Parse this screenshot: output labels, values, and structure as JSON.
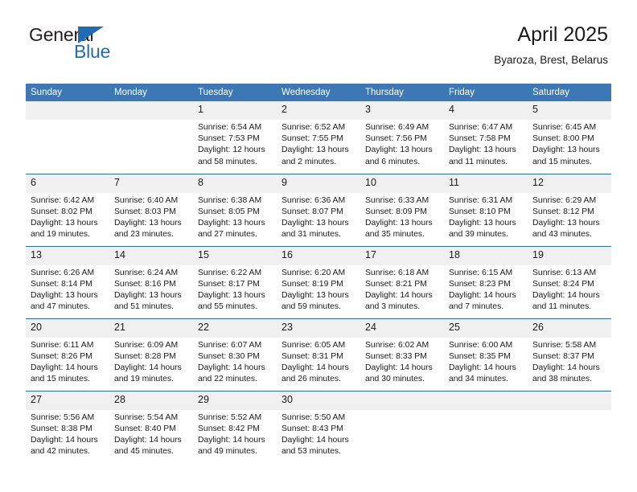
{
  "brand": {
    "name_top": "General",
    "name_bottom": "Blue",
    "triangle_icon": "triangle-icon",
    "accent_color": "#1f6cb4"
  },
  "header": {
    "title": "April 2025",
    "subtitle": "Byaroza, Brest, Belarus"
  },
  "calendar": {
    "header_bg": "#3d77b5",
    "daynum_bg": "#f0f0f0",
    "divider_color": "#2b6cab",
    "weekday_labels": [
      "Sunday",
      "Monday",
      "Tuesday",
      "Wednesday",
      "Thursday",
      "Friday",
      "Saturday"
    ],
    "weeks": [
      [
        {
          "day": "",
          "lines": []
        },
        {
          "day": "",
          "lines": []
        },
        {
          "day": "1",
          "lines": [
            "Sunrise: 6:54 AM",
            "Sunset: 7:53 PM",
            "Daylight: 12 hours",
            "and 58 minutes."
          ]
        },
        {
          "day": "2",
          "lines": [
            "Sunrise: 6:52 AM",
            "Sunset: 7:55 PM",
            "Daylight: 13 hours",
            "and 2 minutes."
          ]
        },
        {
          "day": "3",
          "lines": [
            "Sunrise: 6:49 AM",
            "Sunset: 7:56 PM",
            "Daylight: 13 hours",
            "and 6 minutes."
          ]
        },
        {
          "day": "4",
          "lines": [
            "Sunrise: 6:47 AM",
            "Sunset: 7:58 PM",
            "Daylight: 13 hours",
            "and 11 minutes."
          ]
        },
        {
          "day": "5",
          "lines": [
            "Sunrise: 6:45 AM",
            "Sunset: 8:00 PM",
            "Daylight: 13 hours",
            "and 15 minutes."
          ]
        }
      ],
      [
        {
          "day": "6",
          "lines": [
            "Sunrise: 6:42 AM",
            "Sunset: 8:02 PM",
            "Daylight: 13 hours",
            "and 19 minutes."
          ]
        },
        {
          "day": "7",
          "lines": [
            "Sunrise: 6:40 AM",
            "Sunset: 8:03 PM",
            "Daylight: 13 hours",
            "and 23 minutes."
          ]
        },
        {
          "day": "8",
          "lines": [
            "Sunrise: 6:38 AM",
            "Sunset: 8:05 PM",
            "Daylight: 13 hours",
            "and 27 minutes."
          ]
        },
        {
          "day": "9",
          "lines": [
            "Sunrise: 6:36 AM",
            "Sunset: 8:07 PM",
            "Daylight: 13 hours",
            "and 31 minutes."
          ]
        },
        {
          "day": "10",
          "lines": [
            "Sunrise: 6:33 AM",
            "Sunset: 8:09 PM",
            "Daylight: 13 hours",
            "and 35 minutes."
          ]
        },
        {
          "day": "11",
          "lines": [
            "Sunrise: 6:31 AM",
            "Sunset: 8:10 PM",
            "Daylight: 13 hours",
            "and 39 minutes."
          ]
        },
        {
          "day": "12",
          "lines": [
            "Sunrise: 6:29 AM",
            "Sunset: 8:12 PM",
            "Daylight: 13 hours",
            "and 43 minutes."
          ]
        }
      ],
      [
        {
          "day": "13",
          "lines": [
            "Sunrise: 6:26 AM",
            "Sunset: 8:14 PM",
            "Daylight: 13 hours",
            "and 47 minutes."
          ]
        },
        {
          "day": "14",
          "lines": [
            "Sunrise: 6:24 AM",
            "Sunset: 8:16 PM",
            "Daylight: 13 hours",
            "and 51 minutes."
          ]
        },
        {
          "day": "15",
          "lines": [
            "Sunrise: 6:22 AM",
            "Sunset: 8:17 PM",
            "Daylight: 13 hours",
            "and 55 minutes."
          ]
        },
        {
          "day": "16",
          "lines": [
            "Sunrise: 6:20 AM",
            "Sunset: 8:19 PM",
            "Daylight: 13 hours",
            "and 59 minutes."
          ]
        },
        {
          "day": "17",
          "lines": [
            "Sunrise: 6:18 AM",
            "Sunset: 8:21 PM",
            "Daylight: 14 hours",
            "and 3 minutes."
          ]
        },
        {
          "day": "18",
          "lines": [
            "Sunrise: 6:15 AM",
            "Sunset: 8:23 PM",
            "Daylight: 14 hours",
            "and 7 minutes."
          ]
        },
        {
          "day": "19",
          "lines": [
            "Sunrise: 6:13 AM",
            "Sunset: 8:24 PM",
            "Daylight: 14 hours",
            "and 11 minutes."
          ]
        }
      ],
      [
        {
          "day": "20",
          "lines": [
            "Sunrise: 6:11 AM",
            "Sunset: 8:26 PM",
            "Daylight: 14 hours",
            "and 15 minutes."
          ]
        },
        {
          "day": "21",
          "lines": [
            "Sunrise: 6:09 AM",
            "Sunset: 8:28 PM",
            "Daylight: 14 hours",
            "and 19 minutes."
          ]
        },
        {
          "day": "22",
          "lines": [
            "Sunrise: 6:07 AM",
            "Sunset: 8:30 PM",
            "Daylight: 14 hours",
            "and 22 minutes."
          ]
        },
        {
          "day": "23",
          "lines": [
            "Sunrise: 6:05 AM",
            "Sunset: 8:31 PM",
            "Daylight: 14 hours",
            "and 26 minutes."
          ]
        },
        {
          "day": "24",
          "lines": [
            "Sunrise: 6:02 AM",
            "Sunset: 8:33 PM",
            "Daylight: 14 hours",
            "and 30 minutes."
          ]
        },
        {
          "day": "25",
          "lines": [
            "Sunrise: 6:00 AM",
            "Sunset: 8:35 PM",
            "Daylight: 14 hours",
            "and 34 minutes."
          ]
        },
        {
          "day": "26",
          "lines": [
            "Sunrise: 5:58 AM",
            "Sunset: 8:37 PM",
            "Daylight: 14 hours",
            "and 38 minutes."
          ]
        }
      ],
      [
        {
          "day": "27",
          "lines": [
            "Sunrise: 5:56 AM",
            "Sunset: 8:38 PM",
            "Daylight: 14 hours",
            "and 42 minutes."
          ]
        },
        {
          "day": "28",
          "lines": [
            "Sunrise: 5:54 AM",
            "Sunset: 8:40 PM",
            "Daylight: 14 hours",
            "and 45 minutes."
          ]
        },
        {
          "day": "29",
          "lines": [
            "Sunrise: 5:52 AM",
            "Sunset: 8:42 PM",
            "Daylight: 14 hours",
            "and 49 minutes."
          ]
        },
        {
          "day": "30",
          "lines": [
            "Sunrise: 5:50 AM",
            "Sunset: 8:43 PM",
            "Daylight: 14 hours",
            "and 53 minutes."
          ]
        },
        {
          "day": "",
          "lines": []
        },
        {
          "day": "",
          "lines": []
        },
        {
          "day": "",
          "lines": []
        }
      ]
    ]
  }
}
